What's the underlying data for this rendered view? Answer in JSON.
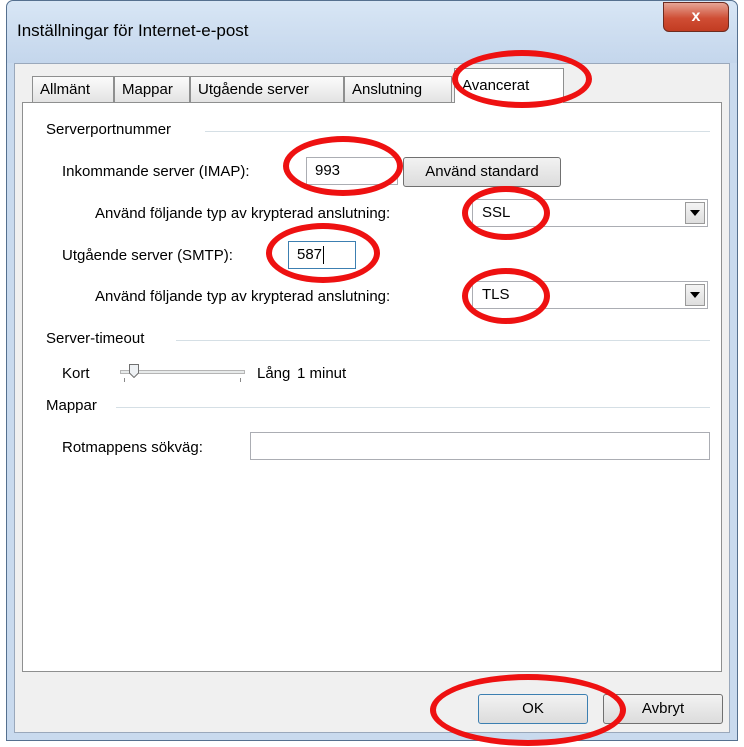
{
  "window": {
    "title": "Inställningar för Internet-e-post",
    "close_symbol": "x"
  },
  "tabs": [
    {
      "label": "Allmänt"
    },
    {
      "label": "Mappar"
    },
    {
      "label": "Utgående server"
    },
    {
      "label": "Anslutning"
    },
    {
      "label": "Avancerat",
      "active": true
    }
  ],
  "server_ports": {
    "section_label": "Serverportnummer",
    "incoming_label": "Inkommande server (IMAP):",
    "incoming_value": "993",
    "use_default_label": "Använd standard",
    "incoming_encryption_label": "Använd följande typ av krypterad anslutning:",
    "incoming_encryption_value": "SSL",
    "outgoing_label": "Utgående server (SMTP):",
    "outgoing_value": "587",
    "outgoing_encryption_label": "Använd följande typ av krypterad anslutning:",
    "outgoing_encryption_value": "TLS"
  },
  "timeout": {
    "section_label": "Server-timeout",
    "short_label": "Kort",
    "long_label": "Lång",
    "value_text": "1 minut",
    "level": 0.05
  },
  "folders": {
    "section_label": "Mappar",
    "root_path_label": "Rotmappens sökväg:",
    "root_path_value": ""
  },
  "footer": {
    "ok_label": "OK",
    "cancel_label": "Avbryt"
  },
  "colors": {
    "annotation": "#ee1111",
    "title_bar": "#c9daee",
    "close_button": "#cf4d34"
  },
  "icons": {
    "close": "close-icon",
    "dropdown": "chevron-down-icon"
  }
}
